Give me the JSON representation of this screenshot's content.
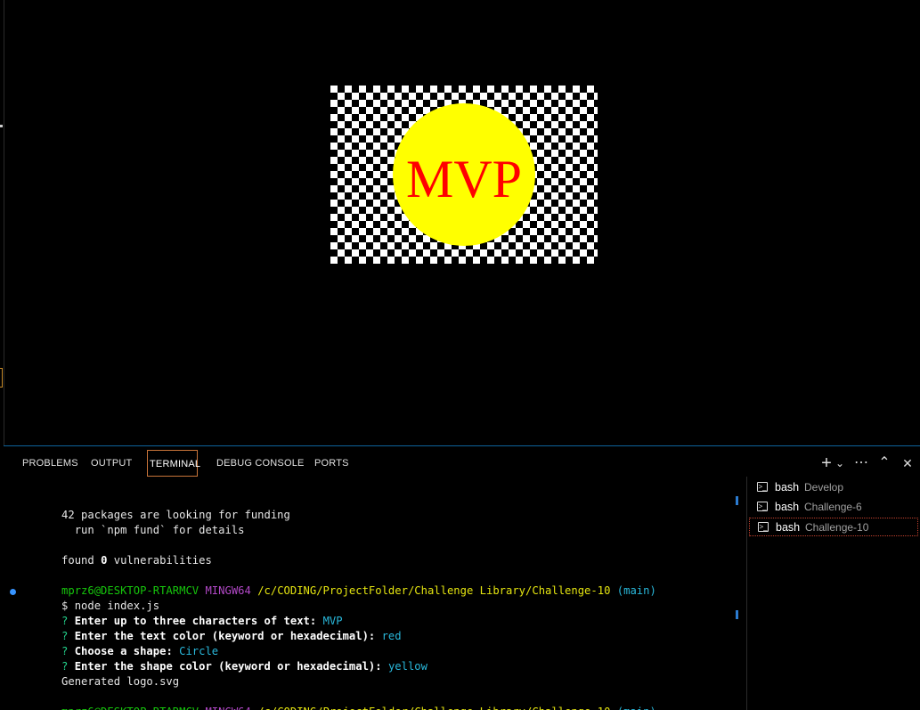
{
  "preview": {
    "logo_text": "MVP",
    "text_color": "#ff0000",
    "shape": "circle",
    "shape_color": "#ffff00"
  },
  "panel": {
    "tabs": [
      {
        "label": "PROBLEMS"
      },
      {
        "label": "OUTPUT"
      },
      {
        "label": "TERMINAL"
      },
      {
        "label": "DEBUG CONSOLE"
      },
      {
        "label": "PORTS"
      }
    ],
    "active_tab": "TERMINAL",
    "actions": {
      "new_terminal": "+",
      "dropdown": "⌄",
      "more": "⋯",
      "maximize": "⌃",
      "close": "✕"
    }
  },
  "terminal": {
    "funding_line": "42 packages are looking for funding",
    "fund_hint": "  run `npm fund` for details",
    "found_prefix": "found ",
    "found_count": "0",
    "found_suffix": " vulnerabilities",
    "prompt": {
      "user": "mprz6@DESKTOP-RTARMCV",
      "env": "MINGW64",
      "path": "/c/CODING/ProjectFolder/Challenge Library/Challenge-10",
      "branch": "(main)"
    },
    "command": "$ node index.js",
    "questions": [
      {
        "q": "Enter up to three characters of text:",
        "a": "MVP"
      },
      {
        "q": "Enter the text color (keyword or hexadecimal):",
        "a": "red"
      },
      {
        "q": "Choose a shape:",
        "a": "Circle"
      },
      {
        "q": "Enter the shape color (keyword or hexadecimal):",
        "a": "yellow"
      }
    ],
    "question_mark": "?",
    "result": "Generated logo.svg",
    "final_prompt_symbol": "$"
  },
  "terminal_list": [
    {
      "name": "bash",
      "desc": "Develop"
    },
    {
      "name": "bash",
      "desc": "Challenge-6"
    },
    {
      "name": "bash",
      "desc": "Challenge-10"
    }
  ],
  "colors": {
    "accent": "#0e639c",
    "active_tab_border": "#c8743a"
  }
}
